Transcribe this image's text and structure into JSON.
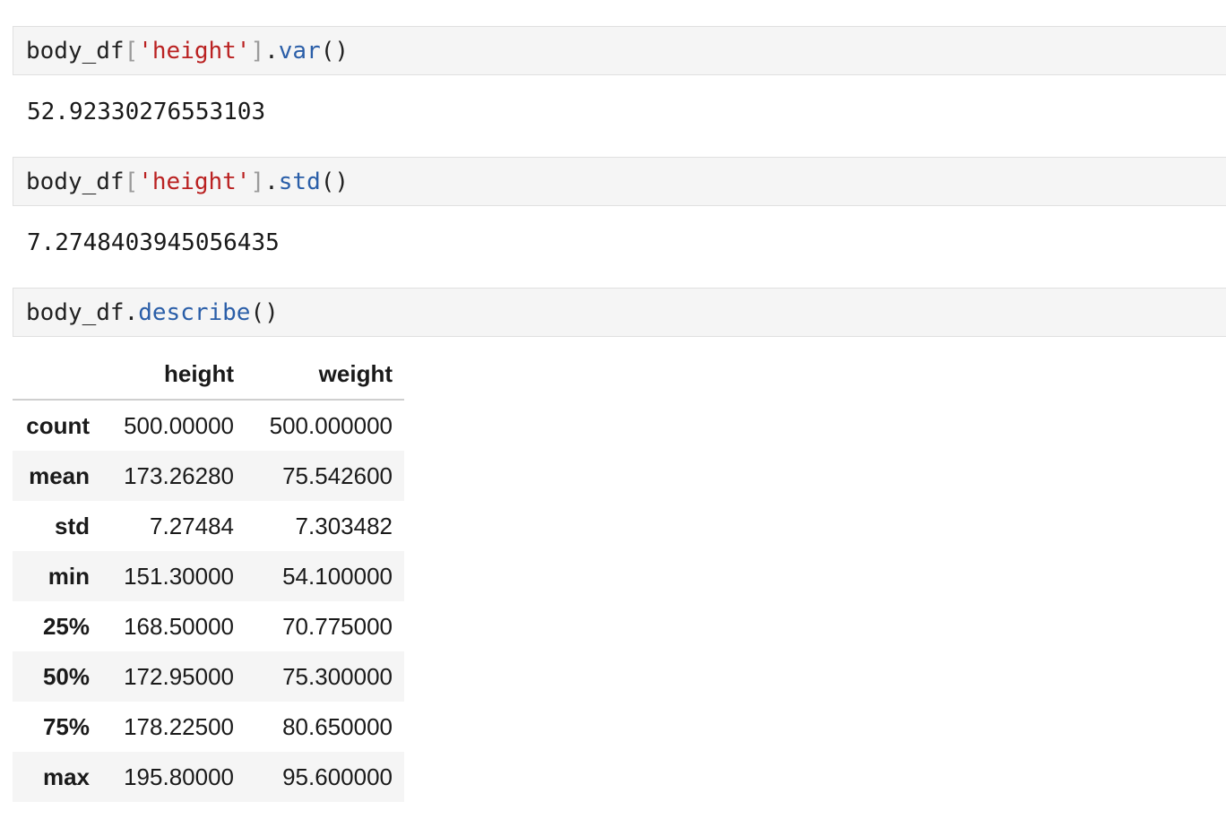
{
  "cells": [
    {
      "input": {
        "var": "body_df",
        "bracket_open": "[",
        "string": "'height'",
        "bracket_close": "]",
        "dot": ".",
        "method": "var",
        "parens": "()"
      },
      "output": "52.92330276553103"
    },
    {
      "input": {
        "var": "body_df",
        "bracket_open": "[",
        "string": "'height'",
        "bracket_close": "]",
        "dot": ".",
        "method": "std",
        "parens": "()"
      },
      "output": "7.2748403945056435"
    },
    {
      "input": {
        "var": "body_df",
        "dot": ".",
        "method": "describe",
        "parens": "()"
      }
    }
  ],
  "describe_table": {
    "columns": [
      "height",
      "weight"
    ],
    "rows": [
      {
        "label": "count",
        "height": "500.00000",
        "weight": "500.000000"
      },
      {
        "label": "mean",
        "height": "173.26280",
        "weight": "75.542600"
      },
      {
        "label": "std",
        "height": "7.27484",
        "weight": "7.303482"
      },
      {
        "label": "min",
        "height": "151.30000",
        "weight": "54.100000"
      },
      {
        "label": "25%",
        "height": "168.50000",
        "weight": "70.775000"
      },
      {
        "label": "50%",
        "height": "172.95000",
        "weight": "75.300000"
      },
      {
        "label": "75%",
        "height": "178.22500",
        "weight": "80.650000"
      },
      {
        "label": "max",
        "height": "195.80000",
        "weight": "95.600000"
      }
    ]
  },
  "colors": {
    "string": "#ba2121",
    "method": "#2a5ea8",
    "bracket": "#9b9b9b",
    "cell_background": "#f5f5f5",
    "cell_border": "#e0e0e0"
  }
}
